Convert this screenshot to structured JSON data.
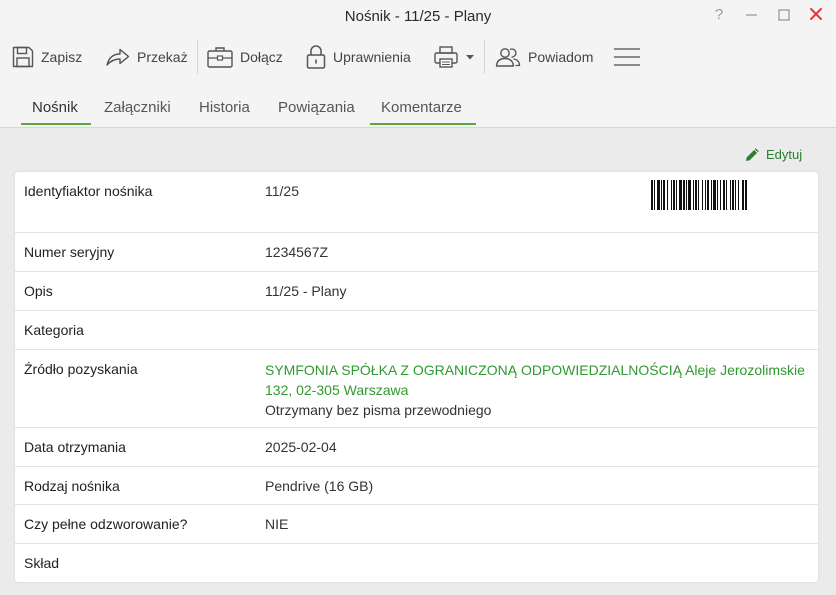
{
  "window": {
    "title": "Nośnik - 11/25 - Plany",
    "help": "?",
    "minimize": "—",
    "maximize": "☐",
    "close": "✕"
  },
  "toolbar": {
    "save": "Zapisz",
    "forward": "Przekaż",
    "attach": "Dołącz",
    "permissions": "Uprawnienia",
    "notify": "Powiadom",
    "icons": [
      "floppy-disk-icon",
      "share-arrow-icon",
      "briefcase-icon",
      "padlock-icon",
      "printer-icon",
      "chevron-down-icon",
      "people-icon",
      "hamburger-menu-icon"
    ]
  },
  "tabs": [
    {
      "label": "Nośnik",
      "active": true
    },
    {
      "label": "Załączniki",
      "active": false
    },
    {
      "label": "Historia",
      "active": false
    },
    {
      "label": "Powiązania",
      "active": false
    },
    {
      "label": "Komentarze",
      "active": false
    }
  ],
  "edit": {
    "label": "Edytuj",
    "icon": "pencil-icon"
  },
  "colors": {
    "accent": "#5aa83a",
    "link": "#2f9a2f",
    "edit": "#2e7d32",
    "close": "#e03a3a"
  },
  "details": {
    "identifier": {
      "label": "Identyfiaktor nośnika",
      "value": "11/25"
    },
    "serial": {
      "label": "Numer seryjny",
      "value": "1234567Z"
    },
    "description": {
      "label": "Opis",
      "value": "11/25 - Plany"
    },
    "category": {
      "label": "Kategoria",
      "value": ""
    },
    "source": {
      "label": "Źródło pozyskania",
      "link": "SYMFONIA SPÓŁKA Z OGRANICZONĄ ODPOWIEDZIALNOŚCIĄ Aleje Jerozolimskie 132, 02-305 Warszawa",
      "note": "Otrzymany bez pisma przewodniego"
    },
    "received_date": {
      "label": "Data otrzymania",
      "value": "2025-02-04"
    },
    "medium_type": {
      "label": "Rodzaj nośnika",
      "value": "Pendrive (16 GB)"
    },
    "full_reproduction": {
      "label": "Czy pełne odzworowanie?",
      "value": "NIE"
    },
    "composition": {
      "label": "Skład",
      "value": ""
    }
  }
}
